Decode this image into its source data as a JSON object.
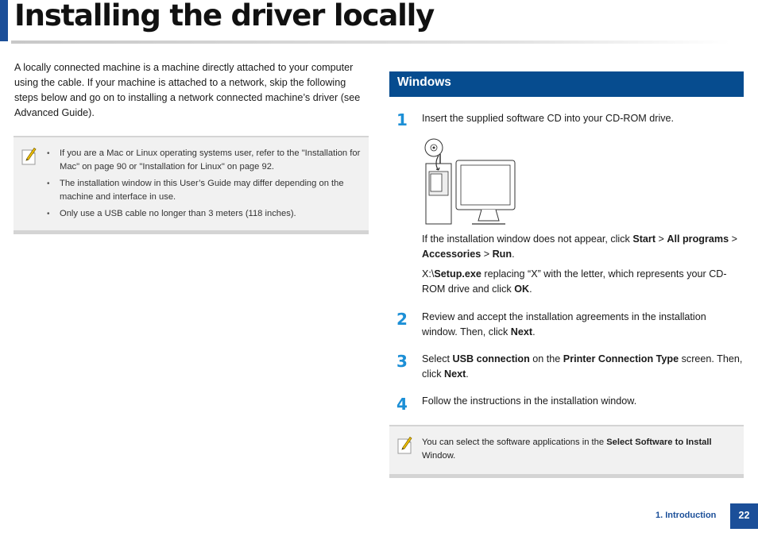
{
  "page": {
    "title": "Installing the driver locally"
  },
  "intro": {
    "text": "A locally connected machine is a machine directly attached to your computer using the cable. If your machine is attached to a network, skip the following steps below and go on to installing a network connected machine’s driver (see Advanced Guide)."
  },
  "note_left": {
    "icon": "note-pencil-icon",
    "items": [
      "If you are a Mac or Linux operating systems user, refer to the \"Installation for Mac\" on page 90 or \"Installation for Linux\" on page 92.",
      "The installation window in this User’s Guide may differ depending on the machine and interface in use.",
      "Only use a USB cable no longer than 3 meters (118 inches)."
    ]
  },
  "section": {
    "title": "Windows",
    "color": "#064c8f"
  },
  "steps": {
    "s1": {
      "number": "1",
      "text": "Insert the supplied software CD into your CD-ROM drive.",
      "illustration": "cd-insert-computer-icon",
      "extra1": {
        "a": "If the installation window does not appear, click ",
        "b1": "Start",
        "sep1": " > ",
        "b2": "All programs",
        "sep2": " > ",
        "b3": "Accessories",
        "sep3": " > ",
        "b4": "Run",
        "end": "."
      },
      "extra2": {
        "a": " X:\\",
        "b1": "Setup.exe",
        "mid": " replacing “X” with the letter, which represents your CD-ROM drive and click ",
        "b2": "OK",
        "end": "."
      }
    },
    "s2": {
      "number": "2",
      "a": "Review and accept the installation agreements in the installation window. Then, click ",
      "b1": "Next",
      "end": "."
    },
    "s3": {
      "number": "3",
      "a": "Select ",
      "b1": "USB connection",
      "mid": " on the ",
      "b2": "Printer Connection Type",
      "mid2": " screen. Then, click ",
      "b3": "Next",
      "end": "."
    },
    "s4": {
      "number": "4",
      "text": "Follow the instructions in the installation window."
    }
  },
  "note_right": {
    "icon": "note-pencil-icon",
    "a": "You can select the software applications in the ",
    "b1": "Select Software to Install",
    "end": " Window."
  },
  "footer": {
    "chapter": "1.  Introduction",
    "page_number": "22",
    "accent": "#1b4f99"
  }
}
